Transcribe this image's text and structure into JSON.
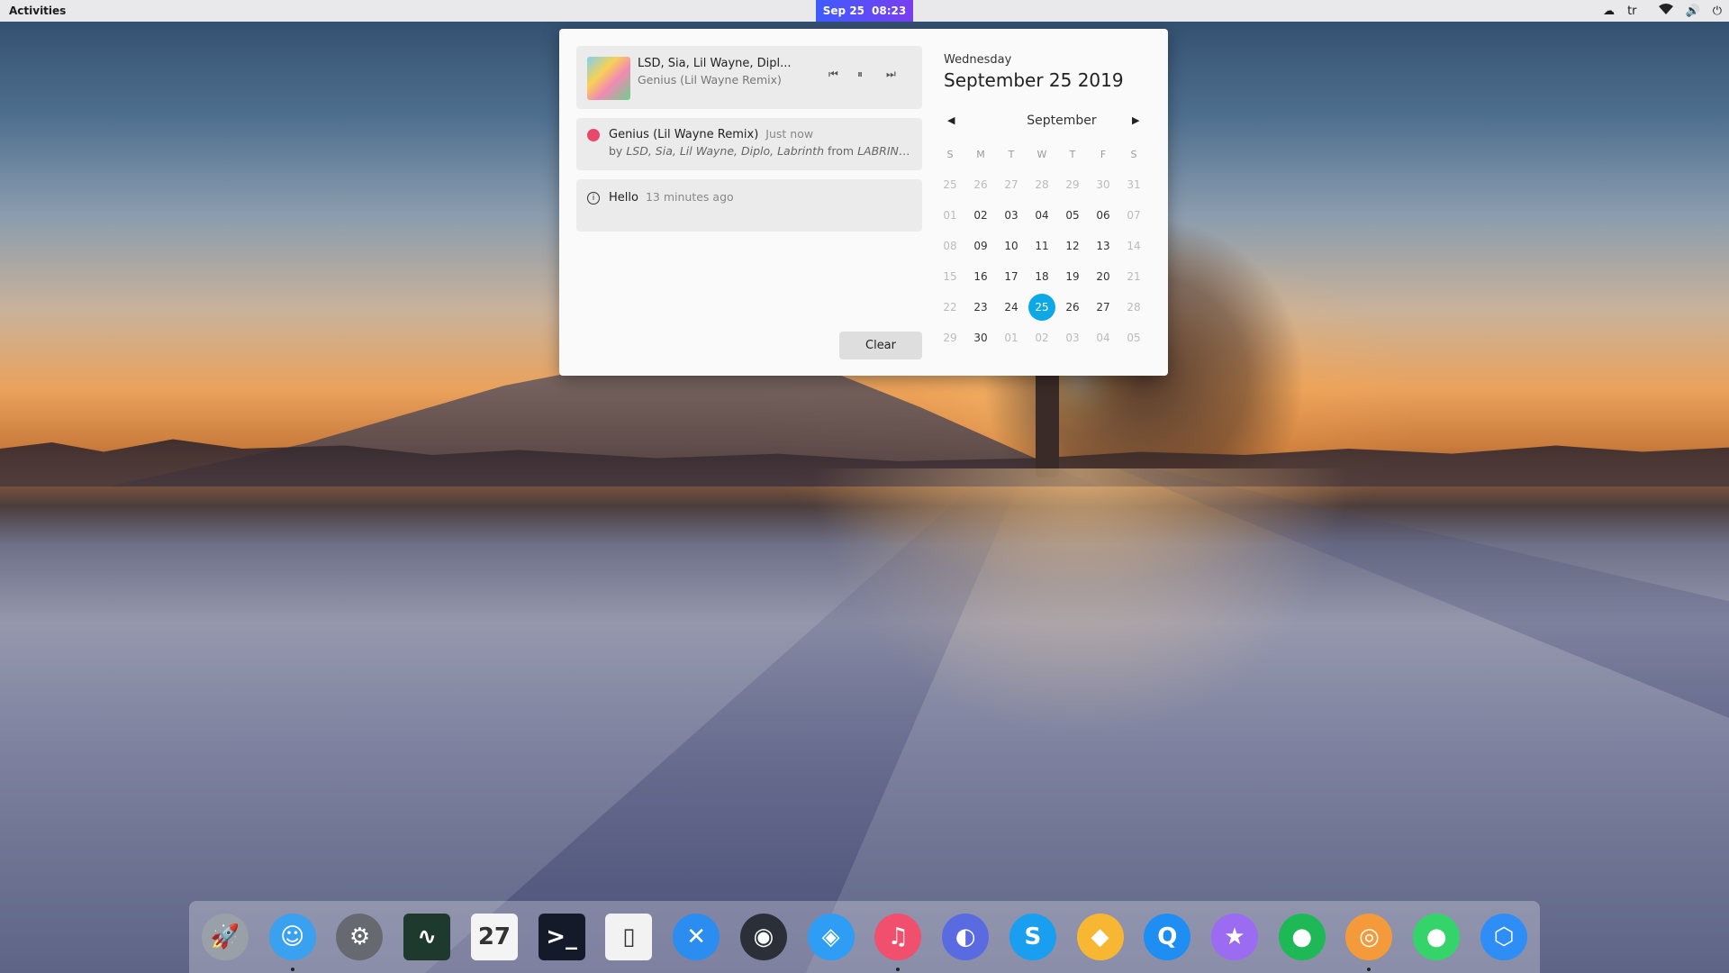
{
  "topbar": {
    "activities": "Activities",
    "clock_date": "Sep 25",
    "clock_time": "08:23",
    "keyboard_layout": "tr"
  },
  "media": {
    "title": "LSD, Sia, Lil Wayne, Dipl...",
    "track": "Genius (Lil Wayne Remix)",
    "prev": "⏮",
    "pause": "⏸",
    "next": "⏭"
  },
  "notifications": [
    {
      "title": "Genius (Lil Wayne Remix)",
      "time": "Just now",
      "by": "by",
      "artists": "LSD, Sia, Lil Wayne, Diplo, Labrinth",
      "from": "from",
      "album": "LABRINTH,..."
    },
    {
      "title": "Hello",
      "time": "13 minutes ago"
    }
  ],
  "clear_label": "Clear",
  "calendar": {
    "weekday": "Wednesday",
    "full_date": "September 25 2019",
    "month": "September",
    "headers": [
      "S",
      "M",
      "T",
      "W",
      "T",
      "F",
      "S"
    ],
    "days": [
      "25",
      "26",
      "27",
      "28",
      "29",
      "30",
      "31",
      "01",
      "02",
      "03",
      "04",
      "05",
      "06",
      "07",
      "08",
      "09",
      "10",
      "11",
      "12",
      "13",
      "14",
      "15",
      "16",
      "17",
      "18",
      "19",
      "20",
      "21",
      "22",
      "23",
      "24",
      "25",
      "26",
      "27",
      "28",
      "29",
      "30",
      "01",
      "02",
      "03",
      "04",
      "05"
    ],
    "today_index": 31
  },
  "dock": [
    {
      "name": "launchpad-icon",
      "glyph": "🚀",
      "color": "#9aa0a8",
      "running": false
    },
    {
      "name": "finder-icon",
      "glyph": "☺",
      "color": "#3aa0f0",
      "running": true
    },
    {
      "name": "settings-icon",
      "glyph": "⚙",
      "color": "#666a70",
      "running": false
    },
    {
      "name": "system-monitor-icon",
      "glyph": "∿",
      "color": "#1e3a2e",
      "running": false
    },
    {
      "name": "calendar-icon",
      "glyph": "27",
      "color": "#f4f4f4",
      "running": false
    },
    {
      "name": "terminal-icon",
      "glyph": ">_",
      "color": "#151a2a",
      "running": false
    },
    {
      "name": "text-editor-icon",
      "glyph": "▯",
      "color": "#f2f2f2",
      "running": false
    },
    {
      "name": "xcode-icon",
      "glyph": "✕",
      "color": "#2c8df0",
      "running": false
    },
    {
      "name": "steam-icon",
      "glyph": "◉",
      "color": "#2b2f38",
      "running": false
    },
    {
      "name": "safari-icon",
      "glyph": "◈",
      "color": "#2f9df4",
      "running": false
    },
    {
      "name": "music-icon",
      "glyph": "♫",
      "color": "#f0506e",
      "running": true
    },
    {
      "name": "discord-icon",
      "glyph": "◐",
      "color": "#5a6ae0",
      "running": false
    },
    {
      "name": "skype-icon",
      "glyph": "S",
      "color": "#1a9ef0",
      "running": false
    },
    {
      "name": "sketch-icon",
      "glyph": "◆",
      "color": "#f7b733",
      "running": false
    },
    {
      "name": "quicktime-icon",
      "glyph": "Q",
      "color": "#1e8ef2",
      "running": false
    },
    {
      "name": "imovie-icon",
      "glyph": "★",
      "color": "#9b6cf2",
      "running": false
    },
    {
      "name": "whatsapp-icon",
      "glyph": "●",
      "color": "#1fb856",
      "running": false
    },
    {
      "name": "budgie-icon",
      "glyph": "◎",
      "color": "#f59a3a",
      "running": true
    },
    {
      "name": "green-app-icon",
      "glyph": "●",
      "color": "#35d46a",
      "running": false
    },
    {
      "name": "hexagon-app-icon",
      "glyph": "⬡",
      "color": "#2f8ef5",
      "running": false
    }
  ]
}
